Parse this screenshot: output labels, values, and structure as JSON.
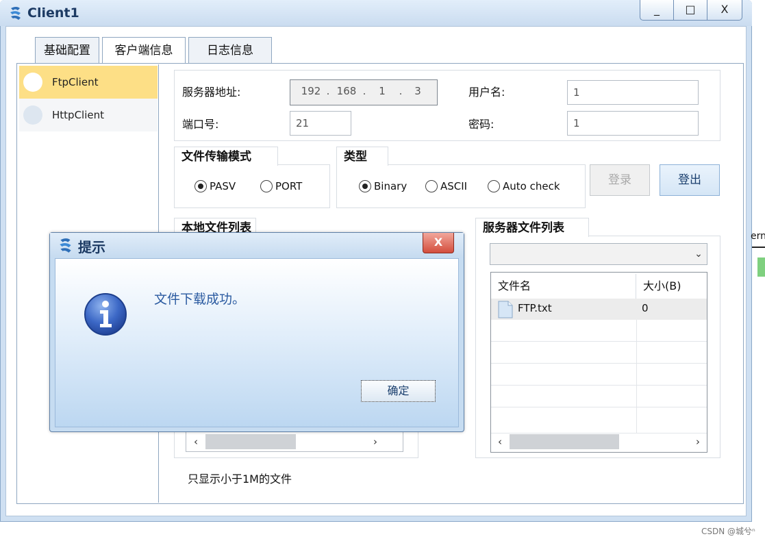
{
  "window": {
    "title": "Client1",
    "min_label": "_",
    "max_label": "□",
    "close_label": "X"
  },
  "tabs": [
    {
      "label": "基础配置"
    },
    {
      "label": "客户端信息"
    },
    {
      "label": "日志信息"
    }
  ],
  "sidebar": {
    "items": [
      {
        "label": "FtpClient",
        "selected": true
      },
      {
        "label": "HttpClient",
        "selected": false
      }
    ]
  },
  "server": {
    "address_label": "服务器地址:",
    "ip": [
      "192",
      "168",
      "1",
      "3"
    ],
    "ip_sep": ".",
    "port_label": "端口号:",
    "port": "21",
    "username_label": "用户名:",
    "username": "1",
    "password_label": "密码:",
    "password": "1"
  },
  "transfer_mode": {
    "title": "文件传输模式",
    "options": [
      {
        "label": "PASV",
        "checked": true
      },
      {
        "label": "PORT",
        "checked": false
      }
    ]
  },
  "type": {
    "title": "类型",
    "options": [
      {
        "label": "Binary",
        "checked": true
      },
      {
        "label": "ASCII",
        "checked": false
      },
      {
        "label": "Auto check",
        "checked": false
      }
    ]
  },
  "actions": {
    "login_label": "登录",
    "logout_label": "登出"
  },
  "local_files": {
    "title": "本地文件列表"
  },
  "server_files": {
    "title": "服务器文件列表",
    "columns": [
      "文件名",
      "大小(B)"
    ],
    "rows": [
      {
        "name": "FTP.txt",
        "size": "0"
      }
    ]
  },
  "note": "只显示小于1M的文件",
  "edge_text": "ern",
  "watermark": "CSDN @城兮ⁿ",
  "dialog": {
    "title": "提示",
    "close_label": "X",
    "message": "文件下载成功。",
    "ok_label": "确定"
  },
  "colors": {
    "selected_item": "#fddf86",
    "dialog_message": "#2a5aa0",
    "title_text": "#1c3a63"
  },
  "scroll": {
    "left_arrow": "‹",
    "right_arrow": "›",
    "dropdown_arrow": "⌄"
  }
}
